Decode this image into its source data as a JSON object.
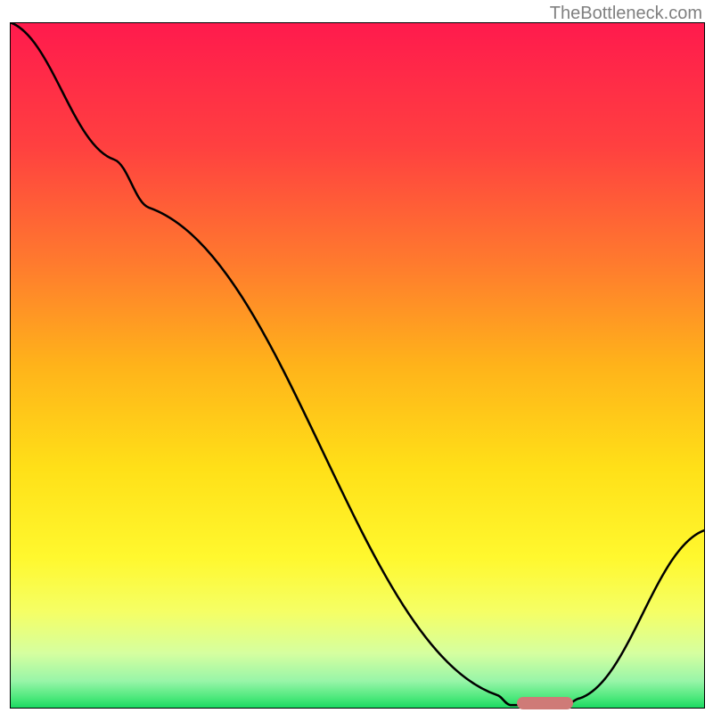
{
  "watermark": "TheBottleneck.com",
  "chart_data": {
    "type": "line",
    "title": "",
    "xlabel": "",
    "ylabel": "",
    "xlim": [
      0,
      100
    ],
    "ylim": [
      0,
      100
    ],
    "gradient_stops": [
      {
        "offset": 0,
        "color": "#ff1a4d"
      },
      {
        "offset": 18,
        "color": "#ff4040"
      },
      {
        "offset": 35,
        "color": "#ff7a2e"
      },
      {
        "offset": 50,
        "color": "#ffb31a"
      },
      {
        "offset": 65,
        "color": "#ffe018"
      },
      {
        "offset": 78,
        "color": "#fff82e"
      },
      {
        "offset": 86,
        "color": "#f5ff66"
      },
      {
        "offset": 92,
        "color": "#d5ffa0"
      },
      {
        "offset": 96,
        "color": "#98f5a8"
      },
      {
        "offset": 98.5,
        "color": "#4ae87a"
      },
      {
        "offset": 100,
        "color": "#18d860"
      }
    ],
    "series": [
      {
        "name": "bottleneck-curve",
        "points": [
          {
            "x": 0,
            "y": 100
          },
          {
            "x": 15,
            "y": 80
          },
          {
            "x": 20,
            "y": 73
          },
          {
            "x": 70,
            "y": 2
          },
          {
            "x": 72,
            "y": 0.5
          },
          {
            "x": 80,
            "y": 0.5
          },
          {
            "x": 82,
            "y": 1.5
          },
          {
            "x": 100,
            "y": 26
          }
        ]
      }
    ],
    "marker": {
      "x_start": 73,
      "x_end": 81,
      "y": 0.8,
      "color": "#cf7a77"
    }
  }
}
